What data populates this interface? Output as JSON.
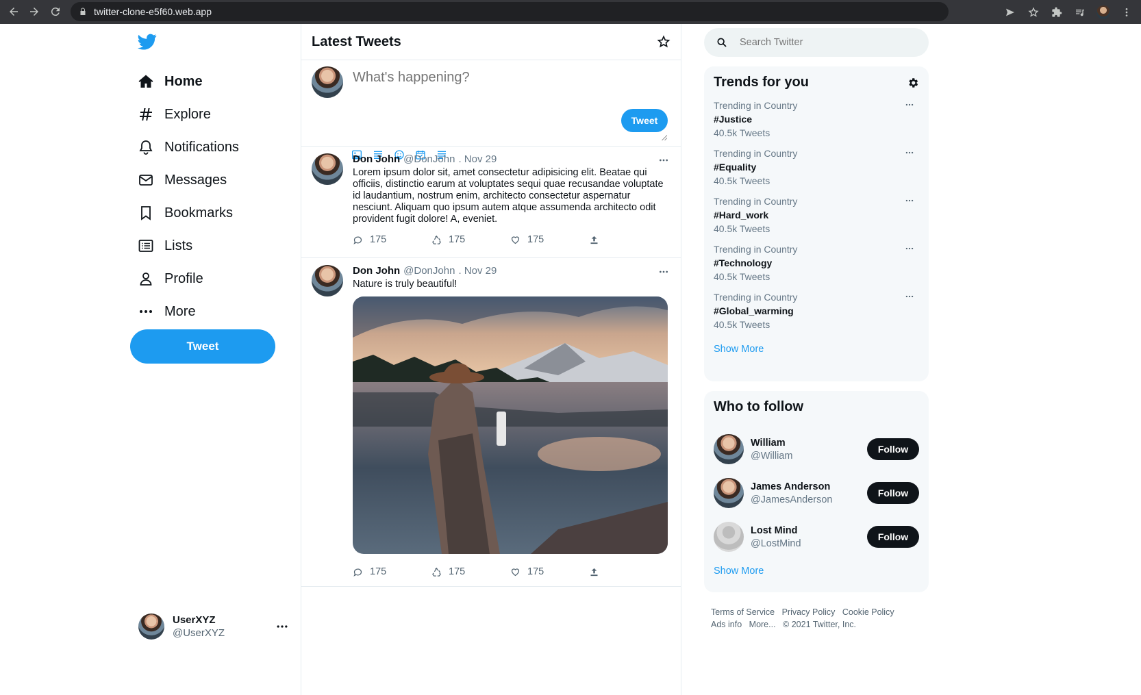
{
  "browser": {
    "url": "twitter-clone-e5f60.web.app"
  },
  "sidebar": {
    "nav": [
      {
        "label": "Home",
        "icon": "home-icon"
      },
      {
        "label": "Explore",
        "icon": "hashtag-icon"
      },
      {
        "label": "Notifications",
        "icon": "bell-icon"
      },
      {
        "label": "Messages",
        "icon": "mail-icon"
      },
      {
        "label": "Bookmarks",
        "icon": "bookmark-icon"
      },
      {
        "label": "Lists",
        "icon": "list-icon"
      },
      {
        "label": "Profile",
        "icon": "user-icon"
      },
      {
        "label": "More",
        "icon": "more-icon"
      }
    ],
    "tweet_button": "Tweet",
    "account": {
      "display_name": "UserXYZ",
      "handle": "@UserXYZ"
    }
  },
  "feed": {
    "title": "Latest Tweets",
    "composer": {
      "placeholder": "What's happening?",
      "tweet_button": "Tweet"
    },
    "posts": [
      {
        "name": "Don John",
        "handle": "@DonJohn",
        "date": ". Nov 29",
        "text": "Lorem ipsum dolor sit, amet consectetur adipisicing elit. Beatae qui officiis, distinctio earum at voluptates sequi quae recusandae voluptate id laudantium, nostrum enim, architecto consectetur aspernatur nesciunt. Aliquam quo ipsum autem atque assumenda architecto odit provident fugit dolore! A, eveniet.",
        "replies": "175",
        "retweets": "175",
        "likes": "175"
      },
      {
        "name": "Don John",
        "handle": "@DonJohn",
        "date": ". Nov 29",
        "text": "Nature is truly beautiful!",
        "replies": "175",
        "retweets": "175",
        "likes": "175"
      }
    ]
  },
  "widgets": {
    "search_placeholder": "Search Twitter",
    "trends": {
      "title": "Trends for you",
      "items": [
        {
          "category": "Trending in Country",
          "tag": "#Justice",
          "count": "40.5k Tweets"
        },
        {
          "category": "Trending in Country",
          "tag": "#Equality",
          "count": "40.5k Tweets"
        },
        {
          "category": "Trending in Country",
          "tag": "#Hard_work",
          "count": "40.5k Tweets"
        },
        {
          "category": "Trending in Country",
          "tag": "#Technology",
          "count": "40.5k Tweets"
        },
        {
          "category": "Trending in Country",
          "tag": "#Global_warming",
          "count": "40.5k Tweets"
        }
      ],
      "show_more": "Show More"
    },
    "who_to_follow": {
      "title": "Who to follow",
      "people": [
        {
          "name": "William",
          "handle": "@William",
          "button": "Follow"
        },
        {
          "name": "James Anderson",
          "handle": "@JamesAnderson",
          "button": "Follow"
        },
        {
          "name": "Lost Mind",
          "handle": "@LostMind",
          "button": "Follow"
        }
      ],
      "show_more": "Show More"
    },
    "footer": {
      "line1": [
        "Terms of Service",
        "Privacy Policy",
        "Cookie Policy"
      ],
      "line2": [
        "Ads info",
        "More...",
        "© 2021 Twitter, Inc."
      ]
    }
  },
  "colors": {
    "accent": "#1d9bf0",
    "text": "#0f1419",
    "muted": "#657786"
  }
}
